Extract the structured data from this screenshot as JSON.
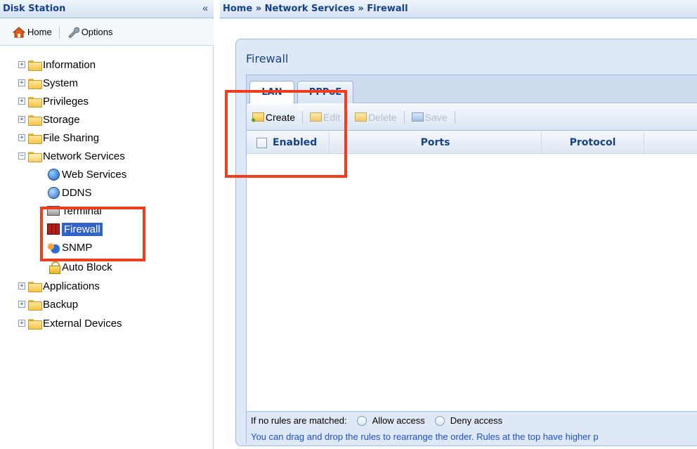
{
  "sidebar": {
    "title": "Disk Station",
    "collapse_glyph": "«",
    "toolbar": {
      "home_label": "Home",
      "options_label": "Options"
    },
    "tree": [
      {
        "label": "Information",
        "expander": "+"
      },
      {
        "label": "System",
        "expander": "+"
      },
      {
        "label": "Privileges",
        "expander": "+"
      },
      {
        "label": "Storage",
        "expander": "+"
      },
      {
        "label": "File Sharing",
        "expander": "+"
      },
      {
        "label": "Network Services",
        "expander": "−"
      },
      {
        "label": "Web Services"
      },
      {
        "label": "DDNS"
      },
      {
        "label": "Terminal"
      },
      {
        "label": "Firewall"
      },
      {
        "label": "SNMP"
      },
      {
        "label": "Auto Block"
      },
      {
        "label": "Applications",
        "expander": "+"
      },
      {
        "label": "Backup",
        "expander": "+"
      },
      {
        "label": "External Devices",
        "expander": "+"
      }
    ]
  },
  "main": {
    "breadcrumb": "Home » Network Services » Firewall",
    "panel_title": "Firewall",
    "tabs": [
      {
        "label": "LAN"
      },
      {
        "label": "PPPoE"
      }
    ],
    "actions": {
      "create": "Create",
      "edit": "Edit",
      "delete": "Delete",
      "save": "Save"
    },
    "columns": [
      {
        "label": "Enabled"
      },
      {
        "label": "Ports"
      },
      {
        "label": "Protocol"
      }
    ],
    "footer": {
      "no_match_label": "If no rules are matched:",
      "allow_label": "Allow access",
      "deny_label": "Deny access",
      "hint": "You can drag and drop the rules to rearrange the order. Rules at the top have higher p"
    }
  },
  "colors": {
    "header_text": "#15428b",
    "selection": "#3162c7",
    "highlight_box": "#f03d1d",
    "hint_text": "#1a4fd0"
  }
}
